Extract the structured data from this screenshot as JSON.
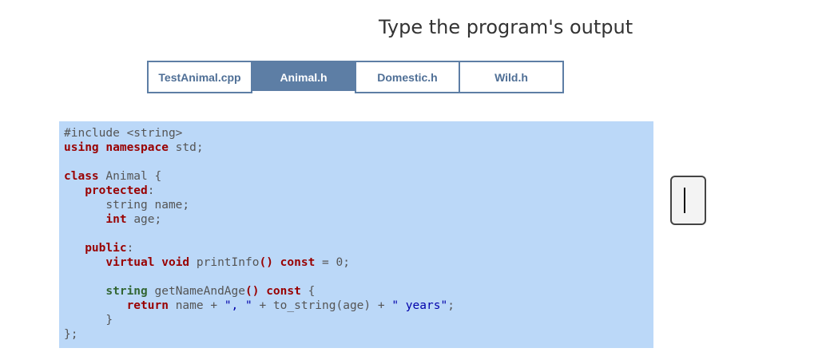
{
  "title": "Type the program's output",
  "tabs": [
    {
      "label": "TestAnimal.cpp",
      "active": false
    },
    {
      "label": "Animal.h",
      "active": true
    },
    {
      "label": "Domestic.h",
      "active": false
    },
    {
      "label": "Wild.h",
      "active": false
    }
  ],
  "code_lines": [
    [
      {
        "t": "#include <string>",
        "c": "pp"
      }
    ],
    [
      {
        "t": "using namespace",
        "c": "kw"
      },
      {
        "t": " std;",
        "c": ""
      }
    ],
    [
      {
        "t": "",
        "c": ""
      }
    ],
    [
      {
        "t": "class",
        "c": "kw"
      },
      {
        "t": " Animal {",
        "c": ""
      }
    ],
    [
      {
        "t": "   ",
        "c": ""
      },
      {
        "t": "protected",
        "c": "kw"
      },
      {
        "t": ":",
        "c": ""
      }
    ],
    [
      {
        "t": "      string name;",
        "c": ""
      }
    ],
    [
      {
        "t": "      ",
        "c": ""
      },
      {
        "t": "int",
        "c": "kw"
      },
      {
        "t": " age;",
        "c": ""
      }
    ],
    [
      {
        "t": "",
        "c": ""
      }
    ],
    [
      {
        "t": "   ",
        "c": ""
      },
      {
        "t": "public",
        "c": "kw"
      },
      {
        "t": ":",
        "c": ""
      }
    ],
    [
      {
        "t": "      ",
        "c": ""
      },
      {
        "t": "virtual void",
        "c": "kw"
      },
      {
        "t": " printInfo",
        "c": ""
      },
      {
        "t": "()",
        "c": "kw"
      },
      {
        "t": " ",
        "c": ""
      },
      {
        "t": "const",
        "c": "kw"
      },
      {
        "t": " = 0;",
        "c": ""
      }
    ],
    [
      {
        "t": "",
        "c": ""
      }
    ],
    [
      {
        "t": "      ",
        "c": ""
      },
      {
        "t": "string",
        "c": "ty"
      },
      {
        "t": " getNameAndAge",
        "c": ""
      },
      {
        "t": "()",
        "c": "kw"
      },
      {
        "t": " ",
        "c": ""
      },
      {
        "t": "const",
        "c": "kw"
      },
      {
        "t": " {",
        "c": ""
      }
    ],
    [
      {
        "t": "         ",
        "c": ""
      },
      {
        "t": "return",
        "c": "kw"
      },
      {
        "t": " name + ",
        "c": ""
      },
      {
        "t": "\", \"",
        "c": "str"
      },
      {
        "t": " + to_string(age) + ",
        "c": ""
      },
      {
        "t": "\" years\"",
        "c": "str"
      },
      {
        "t": ";",
        "c": ""
      }
    ],
    [
      {
        "t": "      }",
        "c": ""
      }
    ],
    [
      {
        "t": "};",
        "c": ""
      }
    ]
  ],
  "answer": {
    "value": ""
  }
}
